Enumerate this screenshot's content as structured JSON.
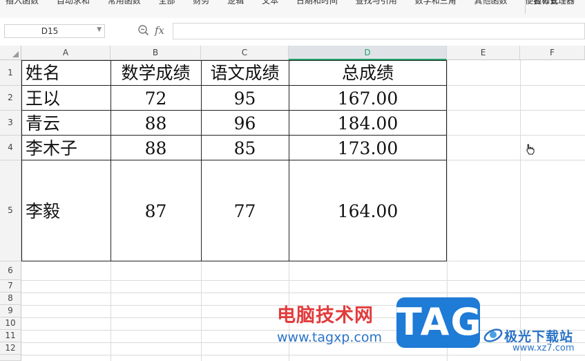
{
  "ribbon": {
    "items": [
      "插入函数",
      "自动求和",
      "常用函数",
      "全部",
      "财务",
      "逻辑",
      "文本",
      "日期和时间",
      "查找与引用",
      "数学和三角",
      "其他函数",
      "便捷公式"
    ],
    "right_item": "名称管理器"
  },
  "formula_bar": {
    "name_box": "D15",
    "fx_label": "fx",
    "formula": ""
  },
  "columns": [
    "A",
    "B",
    "C",
    "D",
    "E",
    "F"
  ],
  "selected_column": "D",
  "rows": [
    "1",
    "2",
    "3",
    "4",
    "5",
    "6",
    "7",
    "8",
    "9",
    "10",
    "11",
    "12"
  ],
  "table": {
    "headers": [
      "姓名",
      "数学成绩",
      "语文成绩",
      "总成绩"
    ],
    "rows": [
      [
        "王以",
        "72",
        "95",
        "167.00"
      ],
      [
        "青云",
        "88",
        "96",
        "184.00"
      ],
      [
        "李木子",
        "88",
        "85",
        "173.00"
      ],
      [
        "李毅",
        "87",
        "77",
        "164.00"
      ]
    ]
  },
  "watermark": {
    "title": "电脑技术网",
    "url": "www.tagxp.com",
    "tag": "TAG",
    "brand": "极光下载站",
    "brand_url": "www.xz7.com"
  },
  "colors": {
    "accent": "#21a366",
    "grid": "#dadada",
    "header_bg": "#f3f3f3",
    "watermark_red": "#e23b3b",
    "watermark_blue": "#2a73c7",
    "tag_blue": "#1e7bd6"
  },
  "icons": {
    "zoom": "zoom-icon",
    "dropdown": "chevron-down-icon",
    "cursor": "pointer-cursor-icon",
    "select_all": "select-all-triangle-icon"
  }
}
